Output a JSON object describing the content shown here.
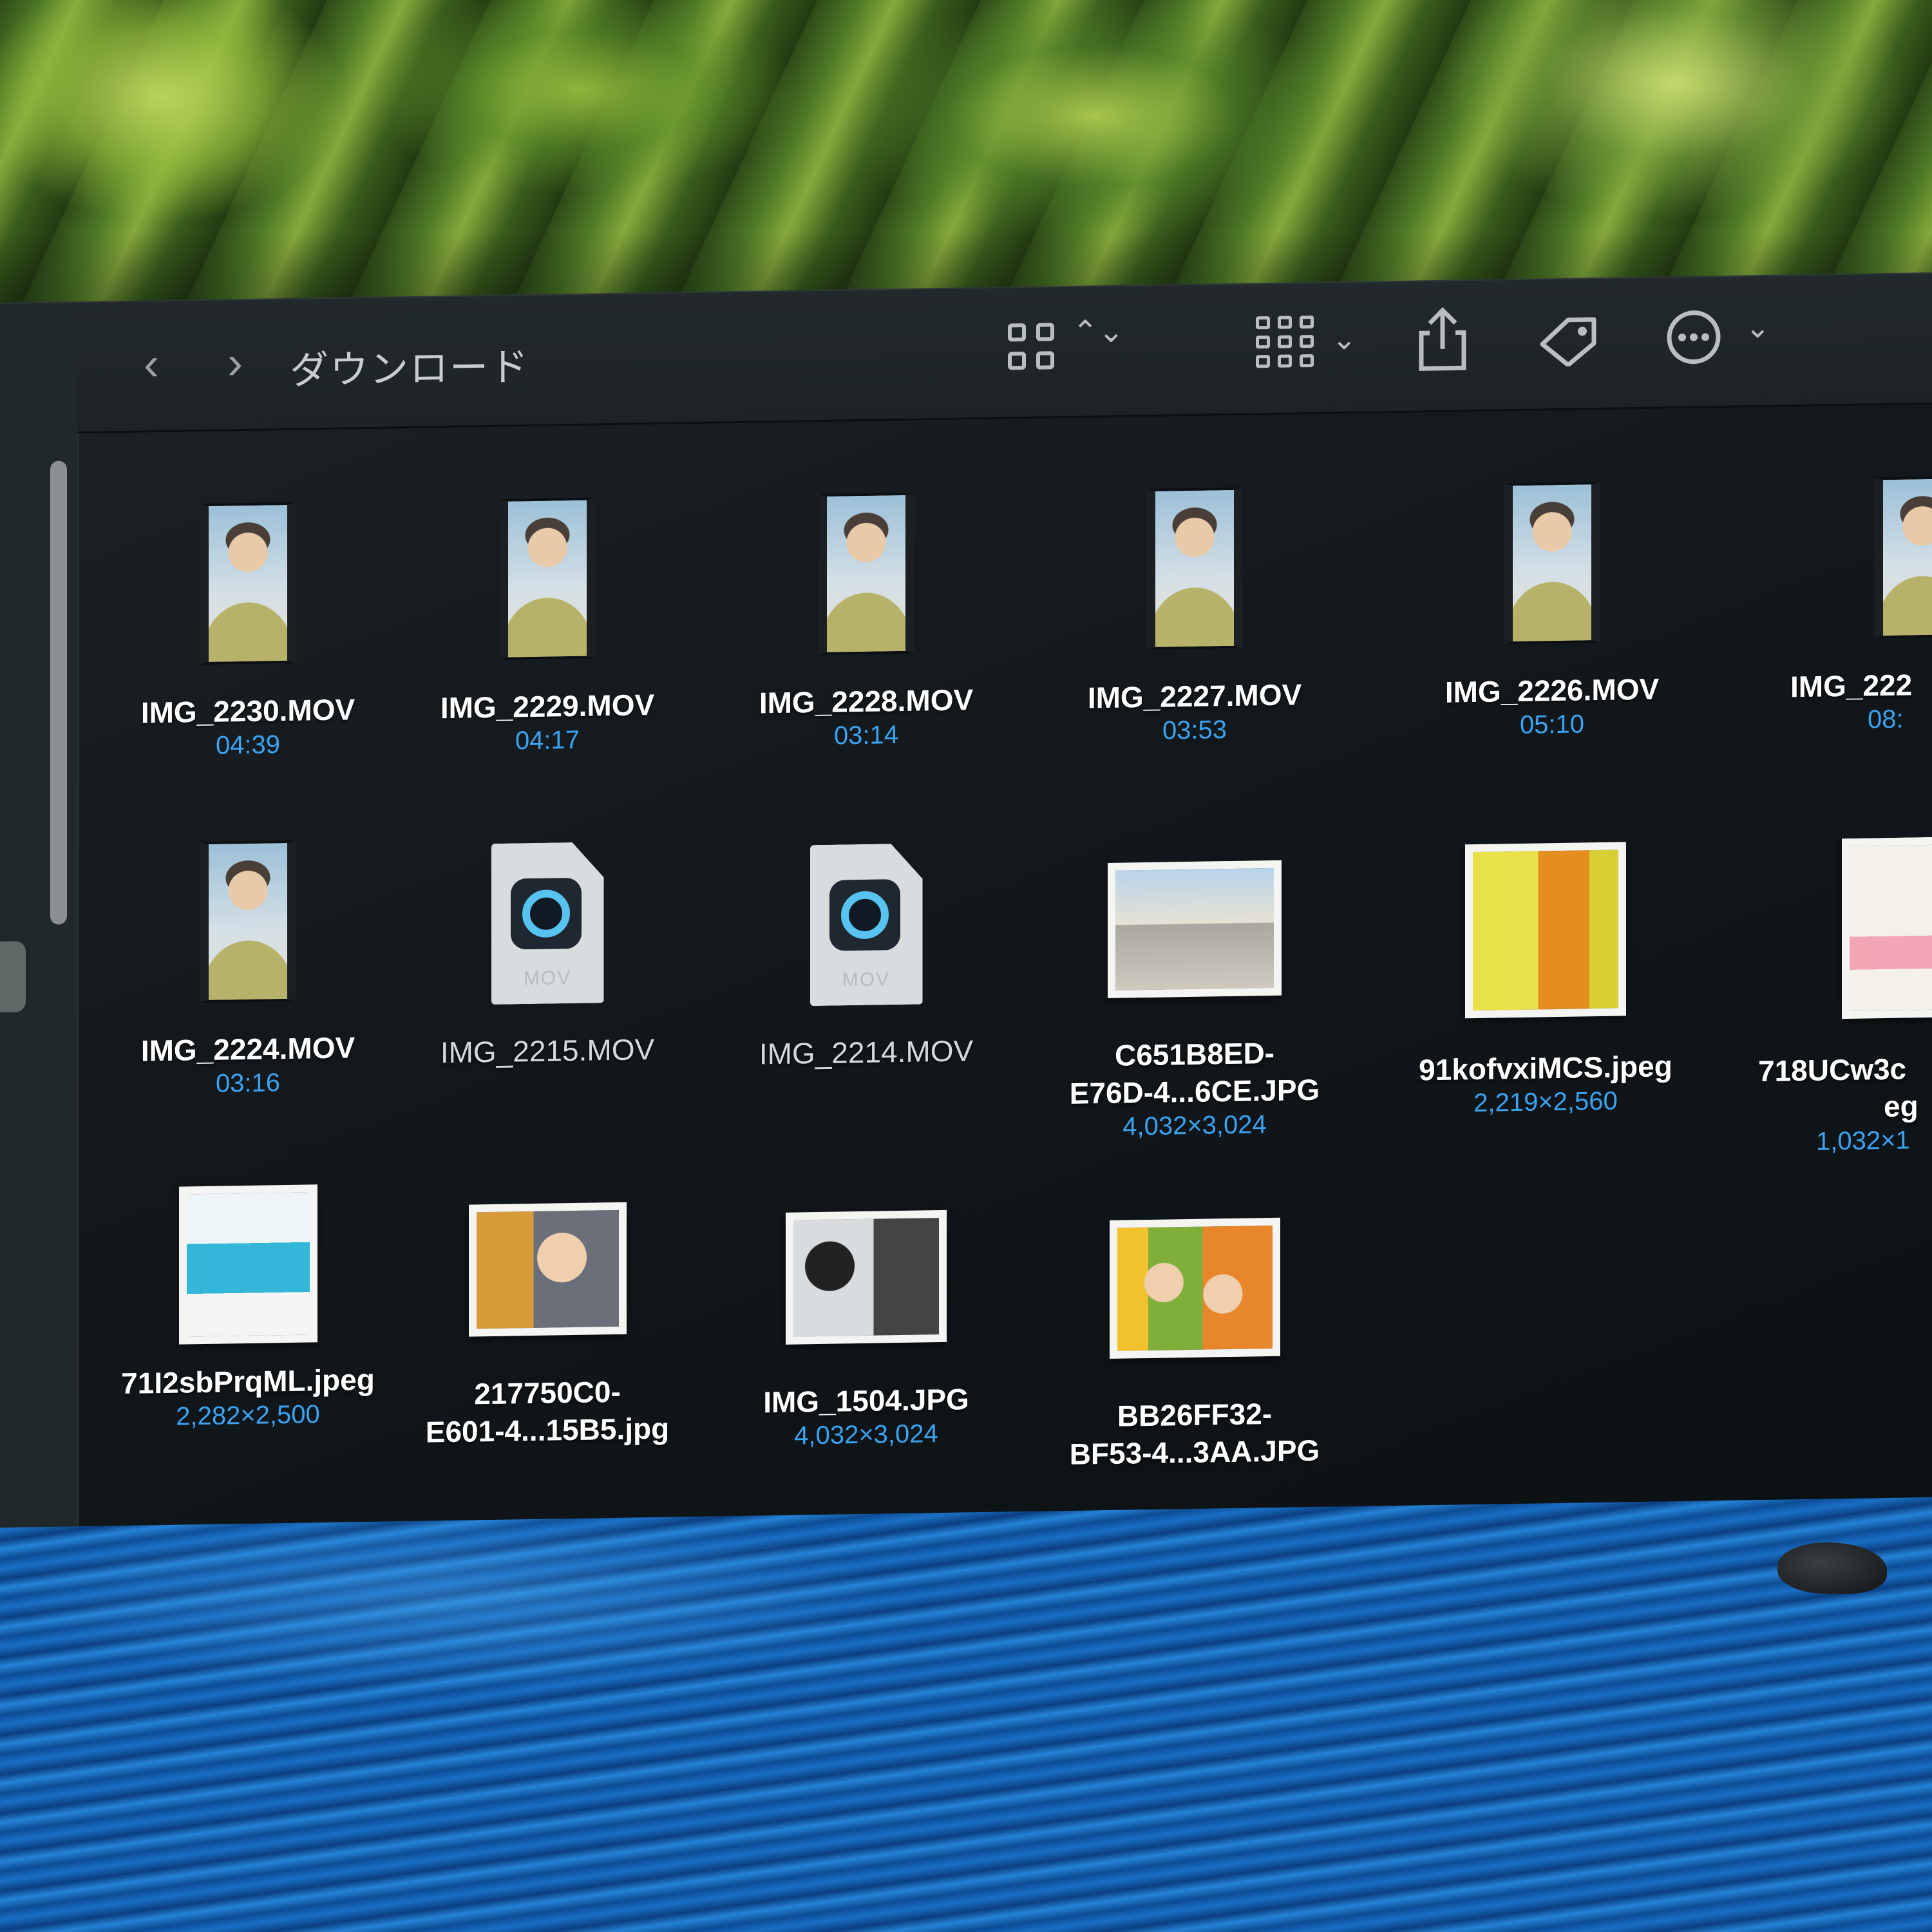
{
  "window": {
    "title": "ダウンロード",
    "back_glyph": "‹",
    "forward_glyph": "›",
    "sort_glyph": "⌃⌄",
    "chevron_glyph": "⌄"
  },
  "icons": {
    "back": "chevron-left-icon",
    "forward": "chevron-right-icon",
    "view_mode": "grid-view-icon",
    "group": "group-icon",
    "share": "share-icon",
    "tag": "tag-icon",
    "more": "ellipsis-circle-icon"
  },
  "files": [
    {
      "name": "IMG_2230.MOV",
      "meta": "04:39",
      "kind": "video"
    },
    {
      "name": "IMG_2229.MOV",
      "meta": "04:17",
      "kind": "video"
    },
    {
      "name": "IMG_2228.MOV",
      "meta": "03:14",
      "kind": "video"
    },
    {
      "name": "IMG_2227.MOV",
      "meta": "03:53",
      "kind": "video"
    },
    {
      "name": "IMG_2226.MOV",
      "meta": "05:10",
      "kind": "video"
    },
    {
      "name": "IMG_222",
      "meta": "08:",
      "kind": "video"
    },
    {
      "name": "IMG_2224.MOV",
      "meta": "03:16",
      "kind": "video"
    },
    {
      "name": "IMG_2215.MOV",
      "kind": "quicktime",
      "ext": "MOV"
    },
    {
      "name": "IMG_2214.MOV",
      "kind": "quicktime",
      "ext": "MOV"
    },
    {
      "name_line1": "C651B8ED-",
      "name_line2": "E76D-4...6CE.JPG",
      "meta": "4,032×3,024",
      "kind": "photo"
    },
    {
      "name": "91kofvxiMCS.jpeg",
      "meta": "2,219×2,560",
      "kind": "photo"
    },
    {
      "name_line1": "718UCw3c",
      "name_line2": "eg",
      "meta": "1,032×1",
      "kind": "photo"
    },
    {
      "name": "71I2sbPrqML.jpeg",
      "meta": "2,282×2,500",
      "kind": "photo"
    },
    {
      "name_line1": "217750C0-",
      "name_line2": "E601-4...15B5.jpg",
      "kind": "photo"
    },
    {
      "name": "IMG_1504.JPG",
      "meta": "4,032×3,024",
      "kind": "photo"
    },
    {
      "name_line1": "BB26FF32-",
      "name_line2": "BF53-4...3AA.JPG",
      "kind": "photo"
    }
  ]
}
